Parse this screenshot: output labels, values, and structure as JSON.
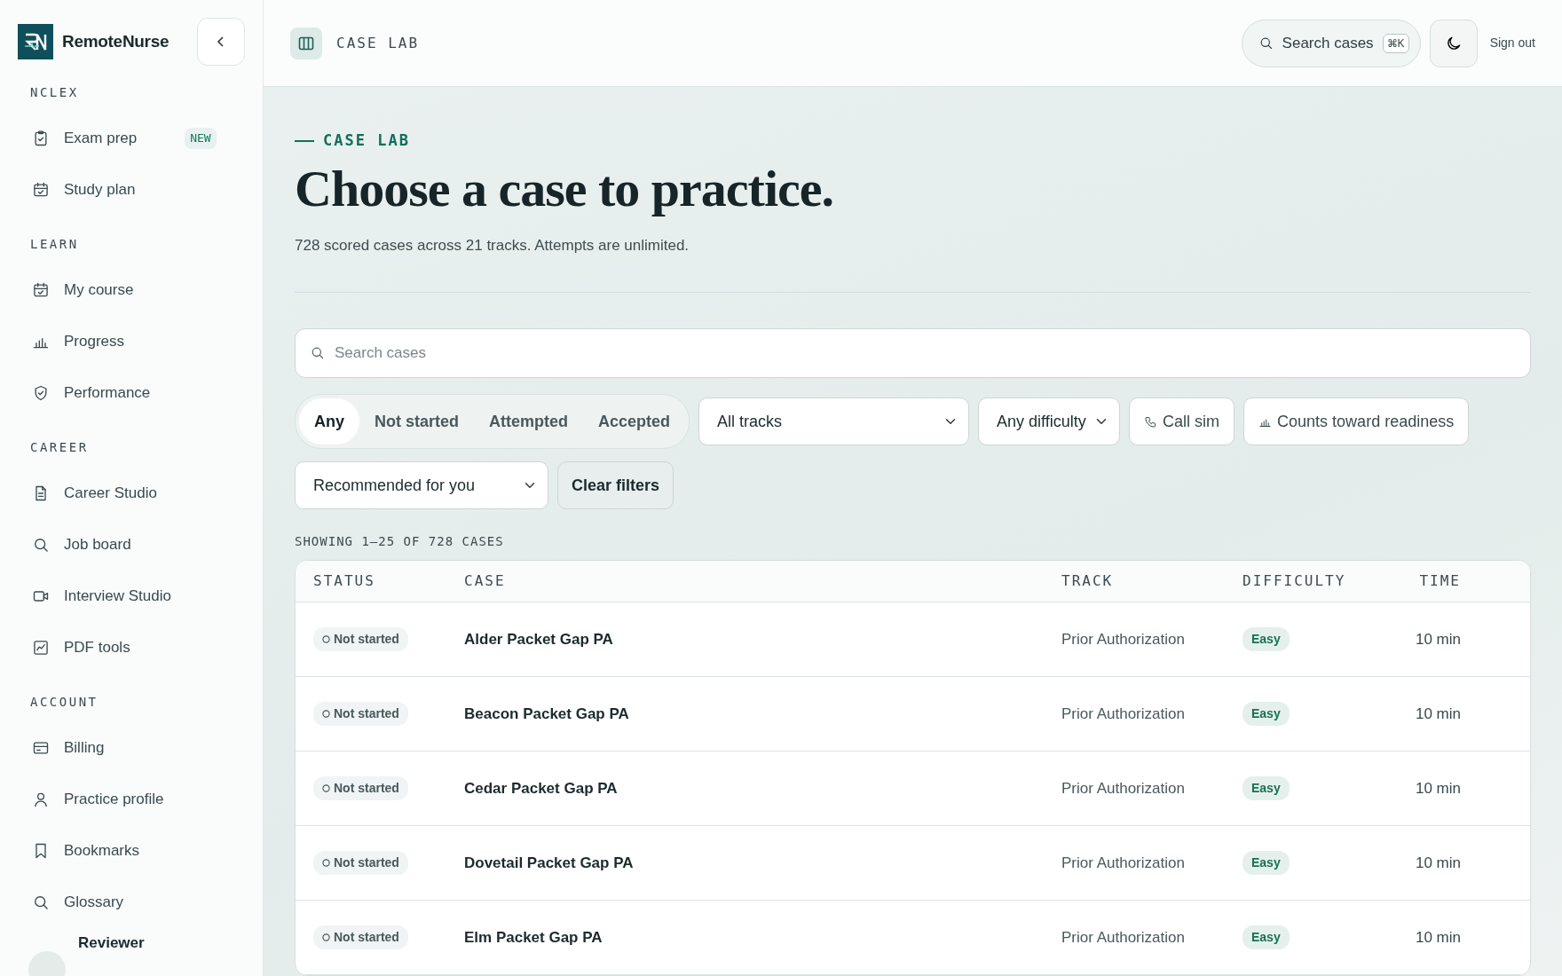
{
  "brand": {
    "name": "RemoteNurse"
  },
  "sidebar": {
    "sections": [
      {
        "title": "NCLEX",
        "items": [
          {
            "label": "Exam prep",
            "kind": "clipboard",
            "badge": "NEW",
            "selected": false
          },
          {
            "label": "Study plan",
            "kind": "calendar",
            "selected": false
          }
        ]
      },
      {
        "title": "LEARN",
        "items": [
          {
            "label": "My course",
            "kind": "calendar",
            "selected": false
          },
          {
            "label": "Progress",
            "kind": "bars",
            "selected": false
          },
          {
            "label": "Performance",
            "kind": "shield",
            "selected": false
          }
        ]
      },
      {
        "title": "CAREER",
        "items": [
          {
            "label": "Career Studio",
            "kind": "document",
            "selected": false
          },
          {
            "label": "Job board",
            "kind": "search",
            "selected": false
          },
          {
            "label": "Interview Studio",
            "kind": "video",
            "selected": false
          },
          {
            "label": "PDF tools",
            "kind": "chart",
            "selected": false
          }
        ]
      },
      {
        "title": "ACCOUNT",
        "items": [
          {
            "label": "Billing",
            "kind": "card",
            "selected": false
          },
          {
            "label": "Practice profile",
            "kind": "person",
            "selected": false
          },
          {
            "label": "Bookmarks",
            "kind": "bookmark",
            "selected": false
          },
          {
            "label": "Glossary",
            "kind": "search",
            "selected": false
          }
        ]
      }
    ],
    "user": {
      "name": "Reviewer"
    }
  },
  "topbar": {
    "title": "CASE LAB",
    "search": "Search cases",
    "shortcut": "⌘K",
    "sign_out": "Sign out"
  },
  "hero": {
    "eyebrow": "CASE LAB",
    "title": "Choose a case to practice.",
    "subtitle": "728 scored cases across 21 tracks. Attempts are unlimited."
  },
  "search": {
    "placeholder": "Search cases"
  },
  "status_tabs": [
    {
      "label": "Any",
      "selected": true
    },
    {
      "label": "Not started",
      "selected": false
    },
    {
      "label": "Attempted",
      "selected": false
    },
    {
      "label": "Accepted",
      "selected": false
    }
  ],
  "filters": {
    "track": "All tracks",
    "difficulty": "Any difficulty",
    "toggles": [
      {
        "label": "Call sim",
        "kind": "phone",
        "on": false
      },
      {
        "label": "Counts toward readiness",
        "kind": "bars",
        "on": false
      }
    ],
    "sort": "Recommended for you",
    "clear": "Clear filters"
  },
  "showing": "SHOWING 1–25 OF 728 CASES",
  "table": {
    "columns": [
      "STATUS",
      "CASE",
      "TRACK",
      "DIFFICULTY",
      "TIME"
    ],
    "rows": [
      {
        "status": "Not started",
        "case": "Alder Packet Gap PA",
        "track": "Prior Authorization",
        "difficulty": "Easy",
        "time": "10 min"
      },
      {
        "status": "Not started",
        "case": "Beacon Packet Gap PA",
        "track": "Prior Authorization",
        "difficulty": "Easy",
        "time": "10 min"
      },
      {
        "status": "Not started",
        "case": "Cedar Packet Gap PA",
        "track": "Prior Authorization",
        "difficulty": "Easy",
        "time": "10 min"
      },
      {
        "status": "Not started",
        "case": "Dovetail Packet Gap PA",
        "track": "Prior Authorization",
        "difficulty": "Easy",
        "time": "10 min"
      },
      {
        "status": "Not started",
        "case": "Elm Packet Gap PA",
        "track": "Prior Authorization",
        "difficulty": "Easy",
        "time": "10 min"
      }
    ]
  }
}
